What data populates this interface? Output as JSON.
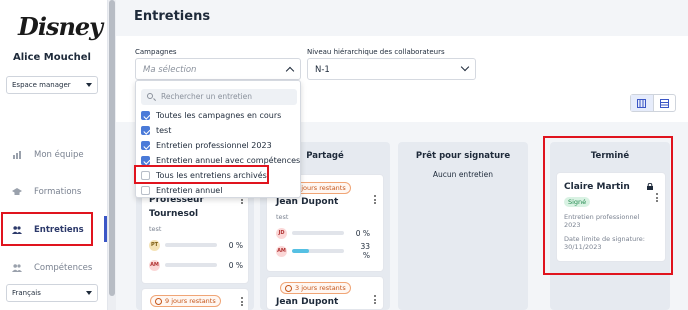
{
  "sidebar": {
    "logo": "Disney",
    "user_name": "Alice Mouchel",
    "space_select": "Espace manager",
    "nav": [
      {
        "label": "Mon équipe",
        "icon": "bar-chart-icon",
        "active": false
      },
      {
        "label": "Formations",
        "icon": "graduation-cap-icon",
        "active": false
      },
      {
        "label": "Entretiens",
        "icon": "people-icon",
        "active": true
      },
      {
        "label": "Compétences",
        "icon": "people-icon",
        "active": false
      }
    ],
    "language": "Français"
  },
  "header": {
    "title": "Entretiens"
  },
  "filters": {
    "campaigns_label": "Campagnes",
    "campaigns_placeholder": "Ma sélection",
    "level_label": "Niveau hiérarchique des collaborateurs",
    "level_value": "N-1"
  },
  "dropdown": {
    "search_placeholder": "Rechercher un entretien",
    "items": [
      {
        "label": "Toutes les campagnes en cours",
        "checked": true
      },
      {
        "label": "test",
        "checked": true
      },
      {
        "label": "Entretien professionnel 2023",
        "checked": true
      },
      {
        "label": "Entretien annuel avec compétences",
        "checked": true
      },
      {
        "label": "Tous les entretiens archivés",
        "checked": false
      },
      {
        "label": "Entretien annuel",
        "checked": false
      }
    ]
  },
  "columns": {
    "col1": {
      "cards": [
        {
          "tag": "",
          "name_line1": "Professeur",
          "name_line2": "Tournesol",
          "sub": "test",
          "rows": [
            {
              "initials": "PT",
              "pct_label": "0 %",
              "pct": 0
            },
            {
              "initials": "AM",
              "pct_label": "0 %",
              "pct": 0
            }
          ]
        },
        {
          "tag": "9 jours restants"
        }
      ]
    },
    "col2": {
      "title": "Partagé",
      "cards": [
        {
          "tag": "9 jours restants",
          "name": "Jean Dupont",
          "sub": "test",
          "rows": [
            {
              "initials": "JD",
              "pct_label": "0 %",
              "pct": 0
            },
            {
              "initials": "AM",
              "pct_label": "33 %",
              "pct": 33
            }
          ]
        },
        {
          "tag": "3 jours restants",
          "name": "Jean Dupont"
        }
      ]
    },
    "col3": {
      "title": "Prêt pour signature",
      "empty": "Aucun entretien"
    },
    "col4": {
      "title": "Terminé",
      "card": {
        "name": "Claire Martin",
        "status": "Signé",
        "campaign": "Entretien professionnel 2023",
        "deadline_label": "Date limite de signature:",
        "deadline": "30/11/2023"
      }
    }
  },
  "colors": {
    "accent": "#3b56c6",
    "highlight": "#e0141e",
    "progress": "#55c0e3",
    "signed_bg": "#d9f2e3"
  }
}
